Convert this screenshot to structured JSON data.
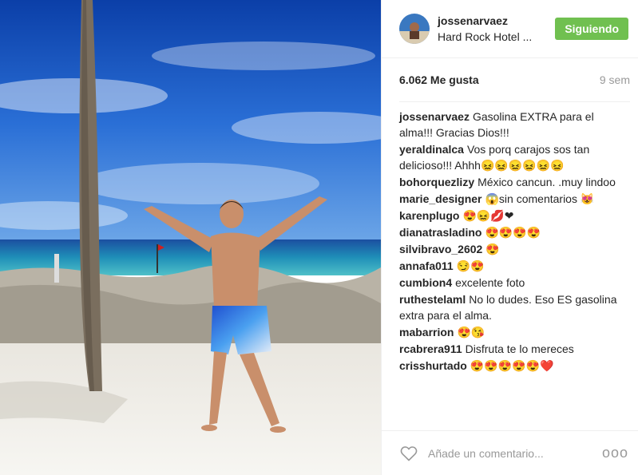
{
  "post": {
    "username": "jossenarvaez",
    "location": "Hard Rock Hotel ...",
    "follow_label": "Siguiendo",
    "likes": "6.062 Me gusta",
    "time_ago": "9 sem",
    "comments": [
      {
        "user": "jossenarvaez",
        "text": "Gasolina EXTRA para el alma!!! Gracias Dios!!!"
      },
      {
        "user": "yeraldinalca",
        "text": "Vos porq carajos sos tan delicioso!!! Ahhh😖😖😖😖😖😖"
      },
      {
        "user": "bohorquezlizy",
        "text": "México cancun. .muy lindoo"
      },
      {
        "user": "marie_designer",
        "text": "😱sin comentarios 😻"
      },
      {
        "user": "karenplugo",
        "text": "😍😖💋❤"
      },
      {
        "user": "dianatrasladino",
        "text": "😍😍😍😍"
      },
      {
        "user": "silvibravo_2602",
        "text": "😍"
      },
      {
        "user": "annafa011",
        "text": "😏😍"
      },
      {
        "user": "cumbion4",
        "text": "excelente foto"
      },
      {
        "user": "ruthestelaml",
        "text": "No lo dudes. Eso ES gasolina extra para el alma."
      },
      {
        "user": "mabarrion",
        "text": "😍😘"
      },
      {
        "user": "rcabrera911",
        "text": "Disfruta te lo mereces"
      },
      {
        "user": "crisshurtado",
        "text": "😍😍😍😍😍❤️"
      }
    ],
    "add_comment_placeholder": "Añade un comentario...",
    "more_label": "ooo"
  },
  "colors": {
    "follow_button": "#70c050",
    "text": "#262626",
    "muted": "#999999",
    "border": "#efefef"
  },
  "icons": [
    "heart-icon",
    "more-options-icon"
  ]
}
